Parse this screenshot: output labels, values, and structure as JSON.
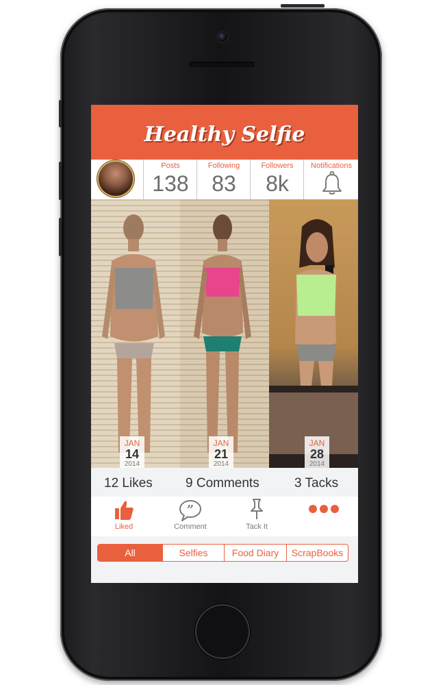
{
  "app": {
    "title": "Healthy Selfie"
  },
  "stats": [
    {
      "label": "Posts",
      "value": "138"
    },
    {
      "label": "Following",
      "value": "83"
    },
    {
      "label": "Followers",
      "value": "8k"
    },
    {
      "label": "Notifications",
      "icon": "bell-icon"
    }
  ],
  "photos": [
    {
      "month": "JAN",
      "day": "14",
      "year": "2014"
    },
    {
      "month": "JAN",
      "day": "21",
      "year": "2014"
    },
    {
      "month": "JAN",
      "day": "28",
      "year": "2014"
    }
  ],
  "counts": {
    "likes": "12 Likes",
    "comments": "9 Comments",
    "tacks": "3 Tacks"
  },
  "actions": {
    "liked": {
      "label": "Liked",
      "icon": "thumbs-up-icon"
    },
    "comment": {
      "label": "Comment",
      "icon": "speech-bubble-icon"
    },
    "tack": {
      "label": "Tack It",
      "icon": "pushpin-icon"
    },
    "more": {
      "icon": "more-dots-icon"
    }
  },
  "tabs": [
    {
      "label": "All",
      "selected": true
    },
    {
      "label": "Selfies",
      "selected": false
    },
    {
      "label": "Food Diary",
      "selected": false
    },
    {
      "label": "ScrapBooks",
      "selected": false
    }
  ],
  "colors": {
    "accent": "#e9603f",
    "text": "#333333",
    "muted": "#6d6d6d"
  }
}
